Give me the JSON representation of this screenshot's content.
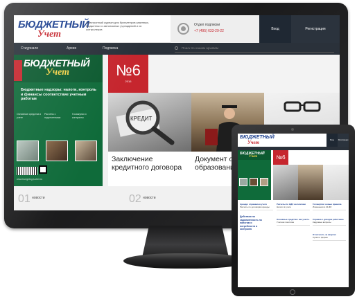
{
  "desktop": {
    "logo": {
      "top": "БЮДЖЕТНЫЙ",
      "bottom": "Учет"
    },
    "tagline": "Электронный журнал для бухгалтеров казенных, бюджетных и автономных учреждений и их контролеров",
    "subscription": {
      "title": "Отдел подписки",
      "phone": "+7 (495) 633-29-22"
    },
    "auth": {
      "login": "Вход",
      "register": "Регистрация"
    },
    "nav": {
      "items": [
        "О журнале",
        "Архив",
        "Подписка"
      ],
      "search_placeholder": "Поиск по нашим архивам"
    },
    "cover": {
      "title_top": "БЮДЖЕТНЫЙ",
      "title_bottom": "Учет",
      "headline": "Бюджетные надзоры: налоги, контроль и финансы соответствие учетным работам",
      "subs": [
        "Основные средства в учете",
        "Расчеты с подотчетными",
        "Госзакупки и контракты"
      ],
      "footer": "www.budgetnyyuchet.ru"
    },
    "issue": {
      "number": "№6",
      "year": "2016"
    },
    "cards": [
      {
        "title": "Заключение кредитного договора",
        "image_text": "КРЕДИТ"
      },
      {
        "title": "Документ об образовании: у"
      }
    ],
    "bottom": [
      {
        "num": "01",
        "label": "новости"
      },
      {
        "num": "02",
        "label": "новости"
      }
    ]
  },
  "tablet": {
    "logo": {
      "top": "БЮДЖЕТНЫЙ",
      "bottom": "Учет"
    },
    "auth": {
      "login": "Вход",
      "register": "Регистрация"
    },
    "issue": "№6",
    "left_feature": "Действия на задолженность по налогам и потребности и контролю",
    "items": [
      {
        "title": "Аренда: отражаем в учете",
        "desc": "Расчеты по договорам аренды"
      },
      {
        "title": "Расчеты по НДС на платежи",
        "desc": "Налоги в учете"
      },
      {
        "title": "Госзакупки: новые правила",
        "desc": "Изменения в 44-ФЗ"
      },
      {
        "title": "Основные средства: как учесть",
        "desc": "Учетная политика"
      },
      {
        "title": "Справка о доходах работника",
        "desc": "Кадровые вопросы"
      },
      {
        "title": "Отчетность за квартал",
        "desc": "Сроки и формы"
      }
    ]
  },
  "colors": {
    "brand_blue": "#1b3f8f",
    "brand_red": "#c6262e",
    "cover_green": "#0f6b3a",
    "nav_dark": "#2a313a"
  }
}
